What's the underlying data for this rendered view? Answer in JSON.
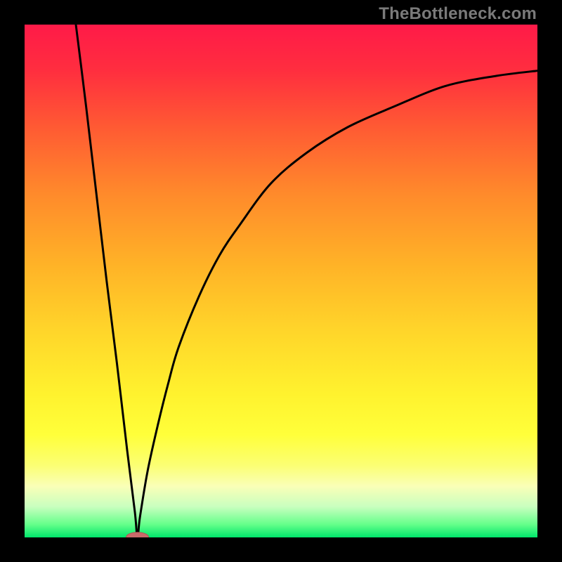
{
  "watermark": "TheBottleneck.com",
  "colors": {
    "frame": "#000000",
    "curve": "#000000",
    "marker_fill": "#c96a6a",
    "marker_stroke": "#b55353",
    "gradient_stops": [
      {
        "offset": 0.0,
        "color": "#ff1a48"
      },
      {
        "offset": 0.09,
        "color": "#ff2e3f"
      },
      {
        "offset": 0.2,
        "color": "#ff5a33"
      },
      {
        "offset": 0.33,
        "color": "#ff8a2b"
      },
      {
        "offset": 0.47,
        "color": "#ffb327"
      },
      {
        "offset": 0.6,
        "color": "#ffd62a"
      },
      {
        "offset": 0.72,
        "color": "#fff22e"
      },
      {
        "offset": 0.8,
        "color": "#ffff3a"
      },
      {
        "offset": 0.86,
        "color": "#fbff74"
      },
      {
        "offset": 0.9,
        "color": "#faffb7"
      },
      {
        "offset": 0.94,
        "color": "#c9ffbf"
      },
      {
        "offset": 0.975,
        "color": "#64ff8a"
      },
      {
        "offset": 1.0,
        "color": "#00e66b"
      }
    ]
  },
  "chart_data": {
    "type": "line",
    "title": "",
    "xlabel": "",
    "ylabel": "",
    "xlim": [
      0,
      100
    ],
    "ylim": [
      0,
      100
    ],
    "note": "V-shaped curve dropping from top-left to a minimum near x≈22, y≈0, then rising with diminishing slope toward the upper right. Values below are approximate readings from the figure.",
    "series": [
      {
        "name": "curve",
        "x": [
          10,
          12,
          14,
          16,
          18,
          20,
          21.5,
          22,
          22.5,
          24,
          26,
          28,
          30,
          34,
          38,
          42,
          48,
          55,
          63,
          72,
          82,
          92,
          100
        ],
        "y": [
          100,
          84,
          67,
          50,
          34,
          17,
          5,
          0,
          4,
          13,
          22,
          30,
          37,
          47,
          55,
          61,
          69,
          75,
          80,
          84,
          88,
          90,
          91
        ]
      }
    ],
    "marker": {
      "x": 22,
      "y": 0,
      "rx": 2.2,
      "ry": 1.0
    }
  }
}
